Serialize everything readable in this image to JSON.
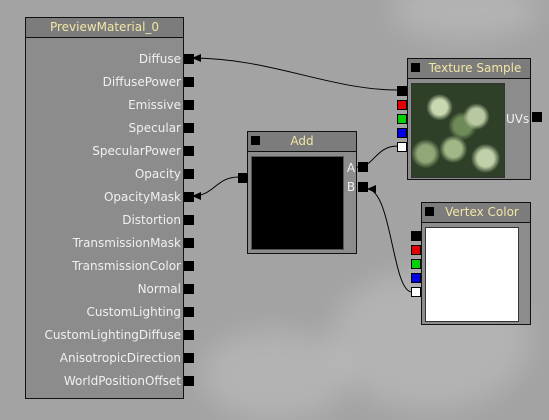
{
  "material_node": {
    "title": "PreviewMaterial_0",
    "inputs": [
      "Diffuse",
      "DiffusePower",
      "Emissive",
      "Specular",
      "SpecularPower",
      "Opacity",
      "OpacityMask",
      "Distortion",
      "TransmissionMask",
      "TransmissionColor",
      "Normal",
      "CustomLighting",
      "CustomLightingDiffuse",
      "AnisotropicDirection",
      "WorldPositionOffset"
    ]
  },
  "add_node": {
    "title": "Add",
    "inputs": [
      "A",
      "B"
    ]
  },
  "texture_node": {
    "title": "Texture Sample",
    "input_label": "UVs",
    "output_colors": [
      "#000000",
      "#e00000",
      "#00d000",
      "#0000e0",
      "#ffffff"
    ]
  },
  "vertex_node": {
    "title": "Vertex Color",
    "output_colors": [
      "#000000",
      "#e00000",
      "#00d000",
      "#0000e0",
      "#ffffff"
    ]
  }
}
